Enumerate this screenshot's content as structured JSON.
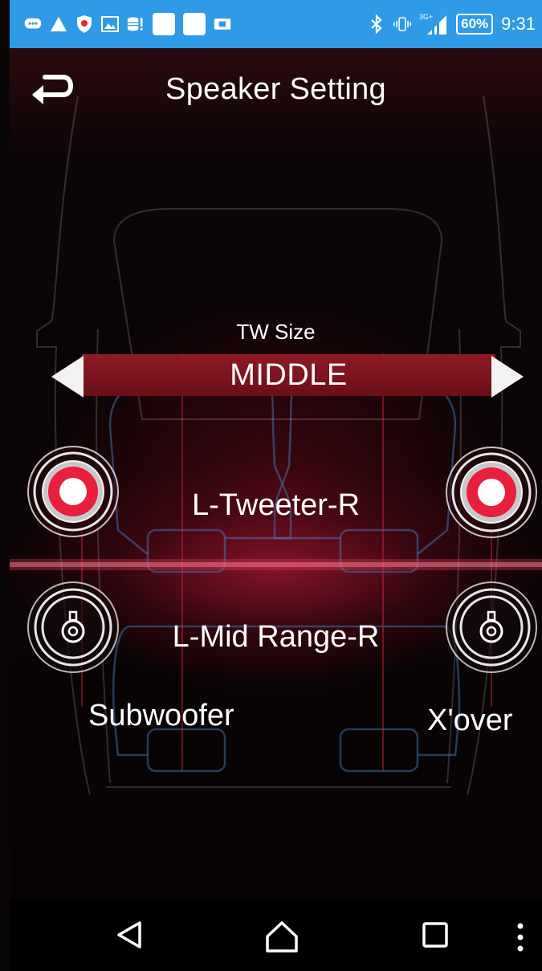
{
  "status_bar": {
    "battery": "60%",
    "time": "9:31",
    "network_label": "3G+"
  },
  "header": {
    "title": "Speaker Setting"
  },
  "tw_size": {
    "label": "TW Size",
    "value": "MIDDLE"
  },
  "rows": {
    "tweeter_label": "L-Tweeter-R",
    "mid_range_label": "L-Mid Range-R"
  },
  "buttons": {
    "subwoofer": "Subwoofer",
    "xover": "X'over"
  },
  "colors": {
    "status_bar": "#2f9ae5",
    "selector": "#8e1a24",
    "active_dot": "#e8203c"
  }
}
